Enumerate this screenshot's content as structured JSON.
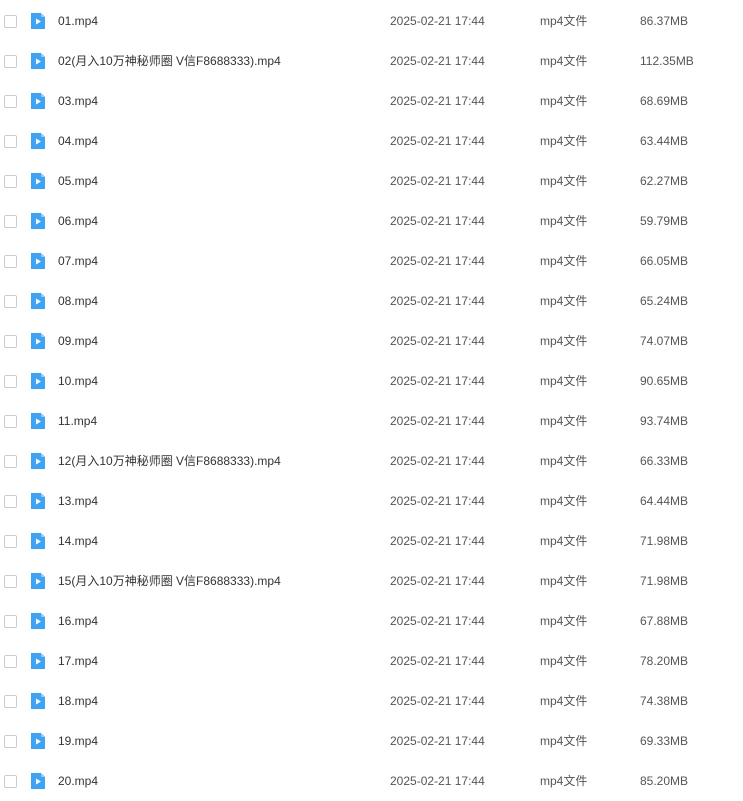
{
  "colors": {
    "icon_blue": "#3ea3f3",
    "icon_blue_fold": "#8cc9ff",
    "text_primary": "#333333",
    "text_secondary": "#555555",
    "checkbox_border": "#c8ccd4"
  },
  "icons": {
    "file": "video-file-icon"
  },
  "files": [
    {
      "name": "01.mp4",
      "date": "2025-02-21 17:44",
      "type": "mp4文件",
      "size": "86.37MB"
    },
    {
      "name": "02(月入10万神秘师圈 V信F8688333).mp4",
      "date": "2025-02-21 17:44",
      "type": "mp4文件",
      "size": "112.35MB"
    },
    {
      "name": "03.mp4",
      "date": "2025-02-21 17:44",
      "type": "mp4文件",
      "size": "68.69MB"
    },
    {
      "name": "04.mp4",
      "date": "2025-02-21 17:44",
      "type": "mp4文件",
      "size": "63.44MB"
    },
    {
      "name": "05.mp4",
      "date": "2025-02-21 17:44",
      "type": "mp4文件",
      "size": "62.27MB"
    },
    {
      "name": "06.mp4",
      "date": "2025-02-21 17:44",
      "type": "mp4文件",
      "size": "59.79MB"
    },
    {
      "name": "07.mp4",
      "date": "2025-02-21 17:44",
      "type": "mp4文件",
      "size": "66.05MB"
    },
    {
      "name": "08.mp4",
      "date": "2025-02-21 17:44",
      "type": "mp4文件",
      "size": "65.24MB"
    },
    {
      "name": "09.mp4",
      "date": "2025-02-21 17:44",
      "type": "mp4文件",
      "size": "74.07MB"
    },
    {
      "name": "10.mp4",
      "date": "2025-02-21 17:44",
      "type": "mp4文件",
      "size": "90.65MB"
    },
    {
      "name": "11.mp4",
      "date": "2025-02-21 17:44",
      "type": "mp4文件",
      "size": "93.74MB"
    },
    {
      "name": "12(月入10万神秘师圈 V信F8688333).mp4",
      "date": "2025-02-21 17:44",
      "type": "mp4文件",
      "size": "66.33MB"
    },
    {
      "name": "13.mp4",
      "date": "2025-02-21 17:44",
      "type": "mp4文件",
      "size": "64.44MB"
    },
    {
      "name": "14.mp4",
      "date": "2025-02-21 17:44",
      "type": "mp4文件",
      "size": "71.98MB"
    },
    {
      "name": "15(月入10万神秘师圈 V信F8688333).mp4",
      "date": "2025-02-21 17:44",
      "type": "mp4文件",
      "size": "71.98MB"
    },
    {
      "name": "16.mp4",
      "date": "2025-02-21 17:44",
      "type": "mp4文件",
      "size": "67.88MB"
    },
    {
      "name": "17.mp4",
      "date": "2025-02-21 17:44",
      "type": "mp4文件",
      "size": "78.20MB"
    },
    {
      "name": "18.mp4",
      "date": "2025-02-21 17:44",
      "type": "mp4文件",
      "size": "74.38MB"
    },
    {
      "name": "19.mp4",
      "date": "2025-02-21 17:44",
      "type": "mp4文件",
      "size": "69.33MB"
    },
    {
      "name": "20.mp4",
      "date": "2025-02-21 17:44",
      "type": "mp4文件",
      "size": "85.20MB"
    }
  ]
}
